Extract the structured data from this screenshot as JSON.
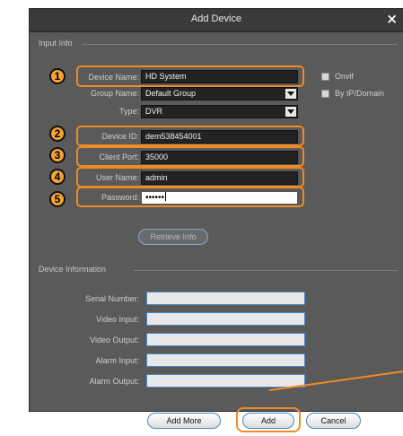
{
  "dialog": {
    "title": "Add Device",
    "close_glyph": "×"
  },
  "input_info": {
    "section_title": "Input Info",
    "device_name": {
      "label": "Device Name:",
      "value": "HD System",
      "badge": "1"
    },
    "group_name": {
      "label": "Group Name:",
      "value": "Default Group"
    },
    "type": {
      "label": "Type:",
      "value": "DVR"
    },
    "device_id": {
      "label": "Device ID:",
      "value": "dem538454001",
      "badge": "2"
    },
    "client_port": {
      "label": "Client Port:",
      "value": "35000",
      "badge": "3"
    },
    "user_name": {
      "label": "User Name:",
      "value": "admin",
      "badge": "4"
    },
    "password": {
      "label": "Password:",
      "value": "••••••",
      "badge": "5"
    },
    "onvif": {
      "label": "Onvif",
      "checked": false
    },
    "by_ip_domain": {
      "label": "By IP/Domain",
      "checked": false
    },
    "retrieve_button": "Retrieve Info"
  },
  "device_information": {
    "section_title": "Device Information",
    "serial_number": {
      "label": "Serial Number:",
      "value": ""
    },
    "video_input": {
      "label": "Video Input:",
      "value": ""
    },
    "video_output": {
      "label": "Video Output:",
      "value": ""
    },
    "alarm_input": {
      "label": "Alarm Input:",
      "value": ""
    },
    "alarm_output": {
      "label": "Alarm Output:",
      "value": ""
    }
  },
  "footer": {
    "add_more": "Add More",
    "add": "Add",
    "cancel": "Cancel"
  },
  "colors": {
    "highlight": "#f08a24",
    "badge_fill": "#f7a233",
    "dialog_bg": "#5a5a5a",
    "field_border_blue": "#4a86c5"
  }
}
